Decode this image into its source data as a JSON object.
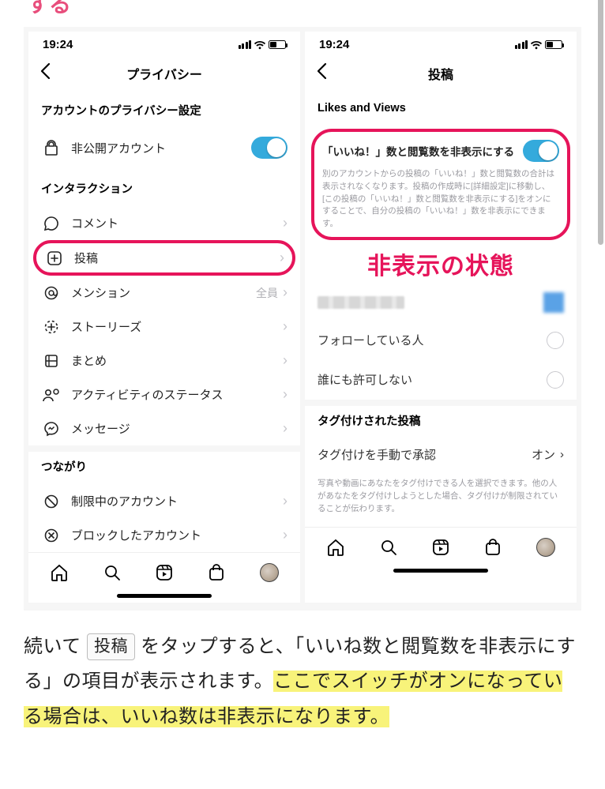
{
  "page": {
    "truncated_heading": "する"
  },
  "left": {
    "status_time": "19:24",
    "nav_title": "プライバシー",
    "section1_title": "アカウントのプライバシー設定",
    "private_account_label": "非公開アカウント",
    "section2_title": "インタラクション",
    "items": {
      "comments": "コメント",
      "posts": "投稿",
      "mentions": "メンション",
      "mentions_meta": "全員",
      "stories": "ストーリーズ",
      "guides": "まとめ",
      "activity_status": "アクティビティのステータス",
      "messages": "メッセージ"
    },
    "section3_title": "つながり",
    "restricted": "制限中のアカウント",
    "blocked": "ブロックしたアカウント"
  },
  "right": {
    "status_time": "19:24",
    "nav_title": "投稿",
    "section1_title": "Likes and Views",
    "hide_likes_label": "「いいね！」数と閲覧数を非表示にする",
    "hide_likes_desc": "別のアカウントからの投稿の「いいね！」数と閲覧数の合計は表示されなくなります。投稿の作成時に[詳細設定]に移動し、[この投稿の「いいね！」数と閲覧数を非表示にする]をオンにすることで、自分の投稿の「いいね！」数を非表示にできます。",
    "big_label": "非表示の状態",
    "opt_following": "フォローしている人",
    "opt_noone": "誰にも許可しない",
    "tagged_section": "タグ付けされた投稿",
    "tagged_manual": "タグ付けを手動で承認",
    "tagged_manual_value": "オン",
    "tagged_desc": "写真や動画にあなたをタグ付けできる人を選択できます。他の人があなたをタグ付けしようとした場合、タグ付けが制限されていることが伝わります。"
  },
  "article": {
    "p1a": "続いて ",
    "kbd": "投稿",
    "p1b": " をタップすると、「いいね数と閲覧数を非表示にする」の項目が表示されます。",
    "mark": "ここでスイッチがオンになっている場合は、いいね数は非表示になります。"
  }
}
